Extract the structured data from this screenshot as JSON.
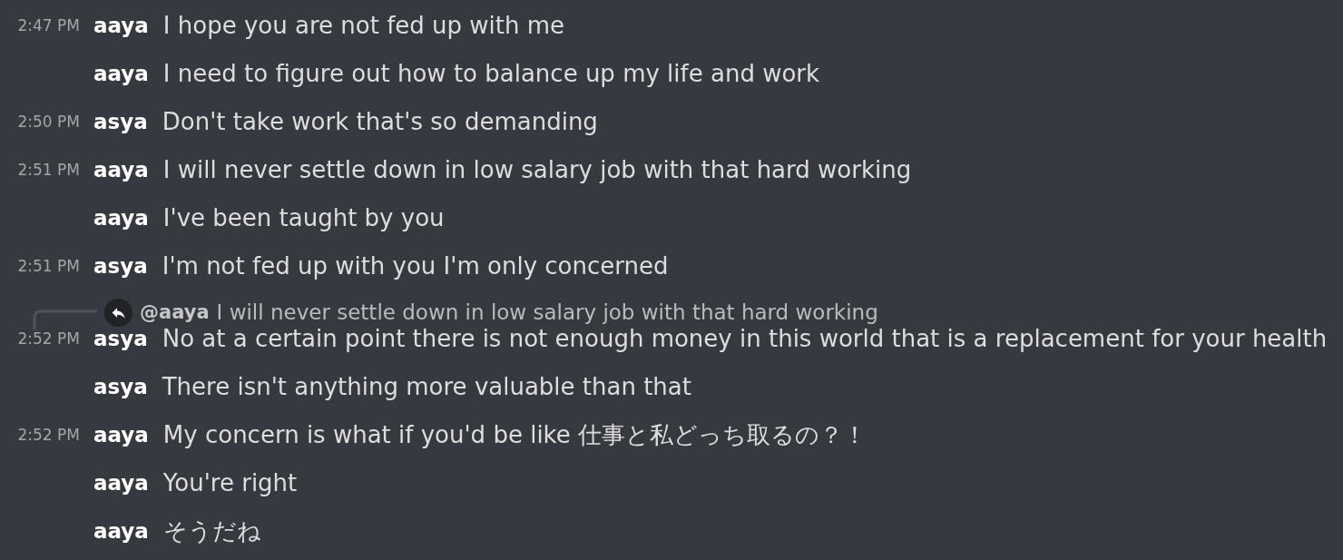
{
  "messages": [
    {
      "timestamp": "2:47 PM",
      "author": "aaya",
      "text": "I hope you are not fed up with me"
    },
    {
      "author": "aaya",
      "text": "I need to figure out how to balance up my life and work"
    },
    {
      "timestamp": "2:50 PM",
      "author": "asya",
      "text": "Don't take work that's so demanding"
    },
    {
      "timestamp": "2:51 PM",
      "author": "aaya",
      "text": "I will never settle down in low salary job with that hard working"
    },
    {
      "author": "aaya",
      "text": "I've been taught by you"
    },
    {
      "timestamp": "2:51 PM",
      "author": "asya",
      "text": "I'm not fed up with you I'm only concerned"
    },
    {
      "timestamp": "2:52 PM",
      "author": "asya",
      "text": "No at a certain point there is not enough money in this world that is a replacement for your health",
      "reply": {
        "mention": "@aaya",
        "text": "I will never settle down in low salary job with that hard working"
      }
    },
    {
      "author": "asya",
      "text": "There isn't anything more valuable than that"
    },
    {
      "timestamp": "2:52 PM",
      "author": "aaya",
      "text": "My concern is what if you'd be like 仕事と私どっち取るの？！"
    },
    {
      "author": "aaya",
      "text": "You're right"
    },
    {
      "author": "aaya",
      "text": "そうだね"
    }
  ]
}
